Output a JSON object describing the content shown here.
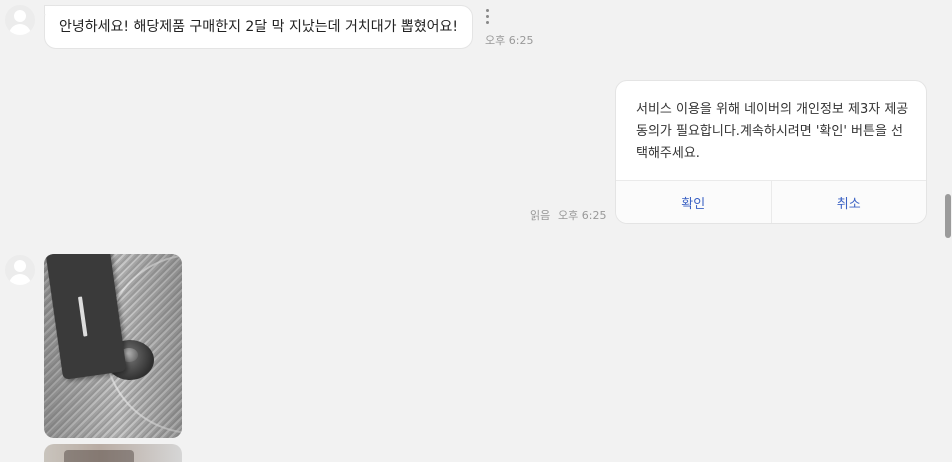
{
  "messages": {
    "incoming_1": {
      "text": "안녕하세요! 해당제품 구매한지 2달 막 지났는데 거치대가 뽑혔어요!",
      "time": "오후 6:25"
    },
    "outgoing_card": {
      "text": "서비스 이용을 위해 네이버의 개인정보 제3자 제공동의가 필요합니다.계속하시려면 '확인' 버튼을 선택해주세요.",
      "read_label": "읽음",
      "time": "오후 6:25",
      "confirm_label": "확인",
      "cancel_label": "취소"
    }
  },
  "colors": {
    "background": "#f2f2f2",
    "bubble": "#ffffff",
    "action_text": "#3b62c4",
    "timestamp": "#999999"
  },
  "icons": {
    "more": "more-vertical-icon",
    "avatar": "default-avatar-icon"
  }
}
